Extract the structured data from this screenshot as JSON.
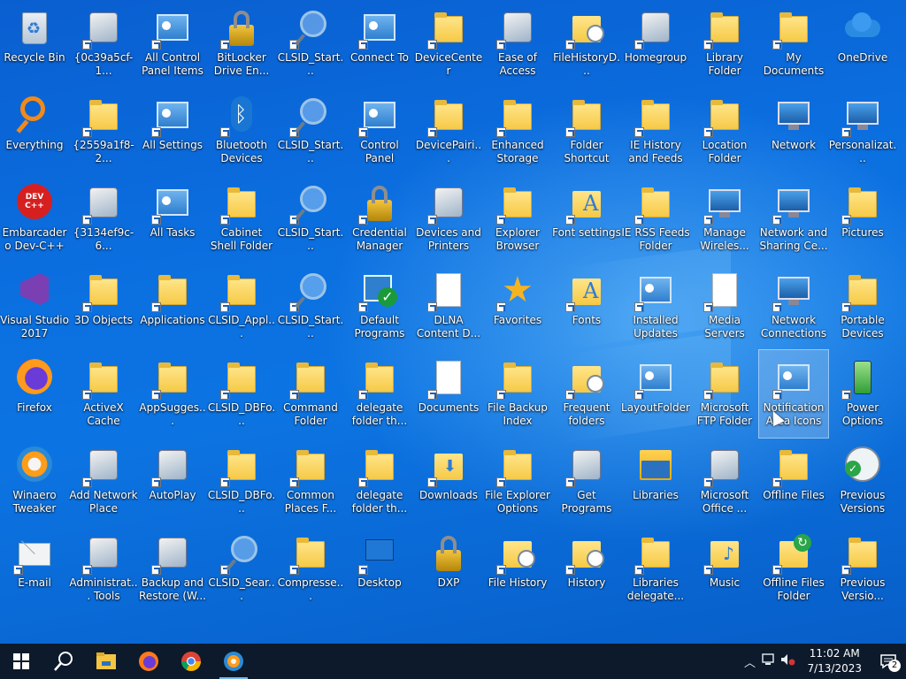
{
  "desktop": {
    "icons": [
      {
        "label": "Recycle Bin",
        "icon": "recycle-bin-icon",
        "cls": "recycle",
        "shortcut": false,
        "col": 0,
        "row": 0
      },
      {
        "label": "{0c39a5cf-1...",
        "icon": "computer-icon",
        "cls": "generic",
        "shortcut": true,
        "col": 1,
        "row": 0
      },
      {
        "label": "All Control Panel Items",
        "icon": "control-panel-icon",
        "cls": "cpanel",
        "shortcut": true,
        "col": 2,
        "row": 0
      },
      {
        "label": "BitLocker Drive En...",
        "icon": "bitlocker-icon",
        "cls": "lock",
        "shortcut": true,
        "col": 3,
        "row": 0
      },
      {
        "label": "CLSID_Start...",
        "icon": "search-icon",
        "cls": "magnifier",
        "shortcut": true,
        "col": 4,
        "row": 0
      },
      {
        "label": "Connect To",
        "icon": "connect-to-icon",
        "cls": "cpanel",
        "shortcut": true,
        "col": 5,
        "row": 0
      },
      {
        "label": "DeviceCenter Initialization",
        "icon": "folder-icon",
        "cls": "folder",
        "shortcut": true,
        "col": 6,
        "row": 0
      },
      {
        "label": "Ease of Access Center",
        "icon": "ease-of-access-icon",
        "cls": "generic",
        "shortcut": true,
        "col": 7,
        "row": 0
      },
      {
        "label": "FileHistoryD...",
        "icon": "folder-icon",
        "cls": "clockfold",
        "shortcut": true,
        "col": 8,
        "row": 0
      },
      {
        "label": "Homegroup",
        "icon": "homegroup-icon",
        "cls": "generic",
        "shortcut": true,
        "col": 9,
        "row": 0
      },
      {
        "label": "Library Folder",
        "icon": "folder-icon",
        "cls": "folder",
        "shortcut": true,
        "col": 10,
        "row": 0
      },
      {
        "label": "My Documents",
        "icon": "documents-icon",
        "cls": "folder",
        "shortcut": true,
        "col": 11,
        "row": 0
      },
      {
        "label": "OneDrive",
        "icon": "onedrive-icon",
        "cls": "onedrive",
        "shortcut": false,
        "col": 12,
        "row": 0
      },
      {
        "label": "Everything",
        "icon": "everything-icon",
        "cls": "everything",
        "shortcut": false,
        "col": 0,
        "row": 1
      },
      {
        "label": "{2559a1f8-2...",
        "icon": "folder-icon",
        "cls": "folder",
        "shortcut": true,
        "col": 1,
        "row": 1
      },
      {
        "label": "All Settings",
        "icon": "control-panel-icon",
        "cls": "cpanel",
        "shortcut": true,
        "col": 2,
        "row": 1
      },
      {
        "label": "Bluetooth Devices",
        "icon": "bluetooth-icon",
        "cls": "bluetooth",
        "shortcut": true,
        "col": 3,
        "row": 1
      },
      {
        "label": "CLSID_Start...",
        "icon": "search-icon",
        "cls": "magnifier",
        "shortcut": true,
        "col": 4,
        "row": 1
      },
      {
        "label": "Control Panel",
        "icon": "control-panel-icon",
        "cls": "cpanel",
        "shortcut": true,
        "col": 5,
        "row": 1
      },
      {
        "label": "DevicePairi... Initialization",
        "icon": "folder-icon",
        "cls": "folder",
        "shortcut": true,
        "col": 6,
        "row": 1
      },
      {
        "label": "Enhanced Storage Da...",
        "icon": "folder-icon",
        "cls": "folder",
        "shortcut": true,
        "col": 7,
        "row": 1
      },
      {
        "label": "Folder Shortcut",
        "icon": "folder-icon",
        "cls": "folder",
        "shortcut": true,
        "col": 8,
        "row": 1
      },
      {
        "label": "IE History and Feeds Shell ...",
        "icon": "folder-icon",
        "cls": "folder",
        "shortcut": true,
        "col": 9,
        "row": 1
      },
      {
        "label": "Location Folder",
        "icon": "folder-icon",
        "cls": "folder",
        "shortcut": true,
        "col": 10,
        "row": 1
      },
      {
        "label": "Network",
        "icon": "network-icon",
        "cls": "network",
        "shortcut": false,
        "col": 11,
        "row": 1
      },
      {
        "label": "Personalizat...",
        "icon": "personalization-icon",
        "cls": "network",
        "shortcut": true,
        "col": 12,
        "row": 1
      },
      {
        "label": "Embarcadero Dev-C++",
        "icon": "devcpp-icon",
        "cls": "devcpp",
        "shortcut": false,
        "col": 0,
        "row": 2
      },
      {
        "label": "{3134ef9c-6...",
        "icon": "computer-icon",
        "cls": "generic",
        "shortcut": true,
        "col": 1,
        "row": 2
      },
      {
        "label": "All Tasks",
        "icon": "control-panel-icon",
        "cls": "cpanel",
        "shortcut": true,
        "col": 2,
        "row": 2
      },
      {
        "label": "Cabinet Shell Folder",
        "icon": "folder-icon",
        "cls": "folder",
        "shortcut": true,
        "col": 3,
        "row": 2
      },
      {
        "label": "CLSID_Start...",
        "icon": "search-icon",
        "cls": "magnifier",
        "shortcut": true,
        "col": 4,
        "row": 2
      },
      {
        "label": "Credential Manager",
        "icon": "credential-manager-icon",
        "cls": "lock",
        "shortcut": true,
        "col": 5,
        "row": 2
      },
      {
        "label": "Devices and Printers",
        "icon": "printer-icon",
        "cls": "generic",
        "shortcut": true,
        "col": 6,
        "row": 2
      },
      {
        "label": "Explorer Browser Res...",
        "icon": "folder-icon",
        "cls": "folder",
        "shortcut": true,
        "col": 7,
        "row": 2
      },
      {
        "label": "Font settings",
        "icon": "fonts-icon",
        "cls": "fonts",
        "shortcut": true,
        "col": 8,
        "row": 2
      },
      {
        "label": "IE RSS Feeds Folder",
        "icon": "folder-icon",
        "cls": "folder",
        "shortcut": true,
        "col": 9,
        "row": 2
      },
      {
        "label": "Manage Wireles...",
        "icon": "wireless-network-icon",
        "cls": "network",
        "shortcut": true,
        "col": 10,
        "row": 2
      },
      {
        "label": "Network and Sharing Ce...",
        "icon": "network-sharing-icon",
        "cls": "network",
        "shortcut": true,
        "col": 11,
        "row": 2
      },
      {
        "label": "Pictures",
        "icon": "pictures-icon",
        "cls": "folder",
        "shortcut": true,
        "col": 12,
        "row": 2
      },
      {
        "label": "Visual Studio 2017",
        "icon": "visual-studio-icon",
        "cls": "vs",
        "shortcut": false,
        "col": 0,
        "row": 3
      },
      {
        "label": "3D Objects",
        "icon": "3d-objects-icon",
        "cls": "folder",
        "shortcut": true,
        "col": 1,
        "row": 3
      },
      {
        "label": "Applications",
        "icon": "folder-icon",
        "cls": "folder",
        "shortcut": true,
        "col": 2,
        "row": 3
      },
      {
        "label": "CLSID_Appl...",
        "icon": "folder-icon",
        "cls": "folder",
        "shortcut": true,
        "col": 3,
        "row": 3
      },
      {
        "label": "CLSID_Start...",
        "icon": "search-icon",
        "cls": "magnifier",
        "shortcut": true,
        "col": 4,
        "row": 3
      },
      {
        "label": "Default Programs",
        "icon": "default-programs-icon",
        "cls": "checkprog",
        "shortcut": true,
        "col": 5,
        "row": 3
      },
      {
        "label": "DLNA Content D...",
        "icon": "document-icon",
        "cls": "doc",
        "shortcut": true,
        "col": 6,
        "row": 3
      },
      {
        "label": "Favorites",
        "icon": "favorites-star-icon",
        "cls": "star",
        "shortcut": true,
        "col": 7,
        "row": 3
      },
      {
        "label": "Fonts",
        "icon": "fonts-icon",
        "cls": "fonts",
        "shortcut": true,
        "col": 8,
        "row": 3
      },
      {
        "label": "Installed Updates",
        "icon": "installed-updates-icon",
        "cls": "cpanel",
        "shortcut": true,
        "col": 9,
        "row": 3
      },
      {
        "label": "Media Servers",
        "icon": "document-icon",
        "cls": "doc",
        "shortcut": true,
        "col": 10,
        "row": 3
      },
      {
        "label": "Network Connections",
        "icon": "network-connections-icon",
        "cls": "network",
        "shortcut": true,
        "col": 11,
        "row": 3
      },
      {
        "label": "Portable Devices",
        "icon": "folder-icon",
        "cls": "folder",
        "shortcut": true,
        "col": 12,
        "row": 3
      },
      {
        "label": "Firefox",
        "icon": "firefox-icon",
        "cls": "firefox",
        "shortcut": false,
        "col": 0,
        "row": 4
      },
      {
        "label": "ActiveX Cache Folder",
        "icon": "folder-icon",
        "cls": "folder",
        "shortcut": true,
        "col": 1,
        "row": 4
      },
      {
        "label": "AppSugges...",
        "icon": "folder-star-icon",
        "cls": "folder",
        "shortcut": true,
        "col": 2,
        "row": 4
      },
      {
        "label": "CLSID_DBFo...",
        "icon": "folder-icon",
        "cls": "folder",
        "shortcut": true,
        "col": 3,
        "row": 4
      },
      {
        "label": "Command Folder",
        "icon": "folder-icon",
        "cls": "folder",
        "shortcut": true,
        "col": 4,
        "row": 4
      },
      {
        "label": "delegate folder th...",
        "icon": "folder-icon",
        "cls": "folder",
        "shortcut": true,
        "col": 5,
        "row": 4
      },
      {
        "label": "Documents",
        "icon": "documents-icon",
        "cls": "doc",
        "shortcut": true,
        "col": 6,
        "row": 4
      },
      {
        "label": "File Backup Index",
        "icon": "folder-icon",
        "cls": "folder",
        "shortcut": true,
        "col": 7,
        "row": 4
      },
      {
        "label": "Frequent folders",
        "icon": "clock-folder-icon",
        "cls": "clockfold",
        "shortcut": true,
        "col": 8,
        "row": 4
      },
      {
        "label": "LayoutFolder",
        "icon": "control-panel-icon",
        "cls": "cpanel",
        "shortcut": true,
        "col": 9,
        "row": 4
      },
      {
        "label": "Microsoft FTP Folder",
        "icon": "ftp-folder-icon",
        "cls": "folder",
        "shortcut": true,
        "col": 10,
        "row": 4
      },
      {
        "label": "Notification Area Icons",
        "icon": "notification-area-icon",
        "cls": "cpanel",
        "shortcut": true,
        "col": 11,
        "row": 4,
        "selected": true
      },
      {
        "label": "Power Options",
        "icon": "battery-icon",
        "cls": "battery",
        "shortcut": true,
        "col": 12,
        "row": 4
      },
      {
        "label": "Winaero Tweaker",
        "icon": "winaero-icon",
        "cls": "winaero",
        "shortcut": false,
        "col": 0,
        "row": 5
      },
      {
        "label": "Add Network Place",
        "icon": "add-network-place-icon",
        "cls": "generic",
        "shortcut": true,
        "col": 1,
        "row": 5
      },
      {
        "label": "AutoPlay",
        "icon": "autoplay-icon",
        "cls": "generic",
        "shortcut": true,
        "col": 2,
        "row": 5
      },
      {
        "label": "CLSID_DBFo...",
        "icon": "folder-icon",
        "cls": "folder",
        "shortcut": true,
        "col": 3,
        "row": 5
      },
      {
        "label": "Common Places F...",
        "icon": "folder-icon",
        "cls": "folder",
        "shortcut": true,
        "col": 4,
        "row": 5
      },
      {
        "label": "delegate folder th...",
        "icon": "folder-icon",
        "cls": "folder",
        "shortcut": true,
        "col": 5,
        "row": 5
      },
      {
        "label": "Downloads",
        "icon": "downloads-icon",
        "cls": "downloads",
        "shortcut": true,
        "col": 6,
        "row": 5
      },
      {
        "label": "File Explorer Options",
        "icon": "folder-options-icon",
        "cls": "folder",
        "shortcut": true,
        "col": 7,
        "row": 5
      },
      {
        "label": "Get Programs",
        "icon": "get-programs-icon",
        "cls": "generic",
        "shortcut": true,
        "col": 8,
        "row": 5
      },
      {
        "label": "Libraries",
        "icon": "libraries-icon",
        "cls": "libraries",
        "shortcut": false,
        "col": 9,
        "row": 5
      },
      {
        "label": "Microsoft Office ...",
        "icon": "office-envelope-icon",
        "cls": "generic",
        "shortcut": true,
        "col": 10,
        "row": 5
      },
      {
        "label": "Offline Files",
        "icon": "offline-files-icon",
        "cls": "folder",
        "shortcut": true,
        "col": 11,
        "row": 5
      },
      {
        "label": "Previous Versions",
        "icon": "previous-versions-icon",
        "cls": "prevver",
        "shortcut": false,
        "col": 12,
        "row": 5
      },
      {
        "label": "E-mail",
        "icon": "email-icon",
        "cls": "mail",
        "shortcut": true,
        "col": 0,
        "row": 6
      },
      {
        "label": "Administrat... Tools",
        "icon": "admin-tools-icon",
        "cls": "generic",
        "shortcut": true,
        "col": 1,
        "row": 6
      },
      {
        "label": "Backup and Restore (W...",
        "icon": "backup-restore-icon",
        "cls": "generic",
        "shortcut": true,
        "col": 2,
        "row": 6
      },
      {
        "label": "CLSID_Sear...",
        "icon": "search-icon",
        "cls": "magnifier",
        "shortcut": true,
        "col": 3,
        "row": 6
      },
      {
        "label": "Compresse...",
        "icon": "zip-folder-icon",
        "cls": "folder",
        "shortcut": true,
        "col": 4,
        "row": 6
      },
      {
        "label": "Desktop",
        "icon": "desktop-icon",
        "cls": "desktopicon",
        "shortcut": true,
        "col": 5,
        "row": 6
      },
      {
        "label": "DXP",
        "icon": "lock-icon",
        "cls": "lock",
        "shortcut": false,
        "col": 6,
        "row": 6
      },
      {
        "label": "File History",
        "icon": "file-history-icon",
        "cls": "clockfold",
        "shortcut": true,
        "col": 7,
        "row": 6
      },
      {
        "label": "History",
        "icon": "history-icon",
        "cls": "clockfold",
        "shortcut": true,
        "col": 8,
        "row": 6
      },
      {
        "label": "Libraries delegate...",
        "icon": "folder-icon",
        "cls": "folder",
        "shortcut": true,
        "col": 9,
        "row": 6
      },
      {
        "label": "Music",
        "icon": "music-icon",
        "cls": "music",
        "shortcut": true,
        "col": 10,
        "row": 6
      },
      {
        "label": "Offline Files Folder",
        "icon": "offline-files-folder-icon",
        "cls": "offline",
        "shortcut": true,
        "col": 11,
        "row": 6
      },
      {
        "label": "Previous Versio...",
        "icon": "folder-icon",
        "cls": "folder",
        "shortcut": true,
        "col": 12,
        "row": 6
      }
    ]
  },
  "taskbar": {
    "items": [
      {
        "name": "start-button",
        "icon": "windows-logo-icon"
      },
      {
        "name": "search-button",
        "icon": "search-icon"
      },
      {
        "name": "taskbar-file-explorer",
        "icon": "file-explorer-icon"
      },
      {
        "name": "taskbar-firefox",
        "icon": "firefox-icon"
      },
      {
        "name": "taskbar-chrome",
        "icon": "chrome-icon"
      },
      {
        "name": "taskbar-winaero",
        "icon": "winaero-icon",
        "active": true
      }
    ],
    "tray": {
      "time": "11:02 AM",
      "date": "7/13/2023",
      "notifications_count": "2"
    }
  },
  "colors": {
    "taskbar_bg": "#0d1a2b",
    "accent": "#76b9ed"
  }
}
